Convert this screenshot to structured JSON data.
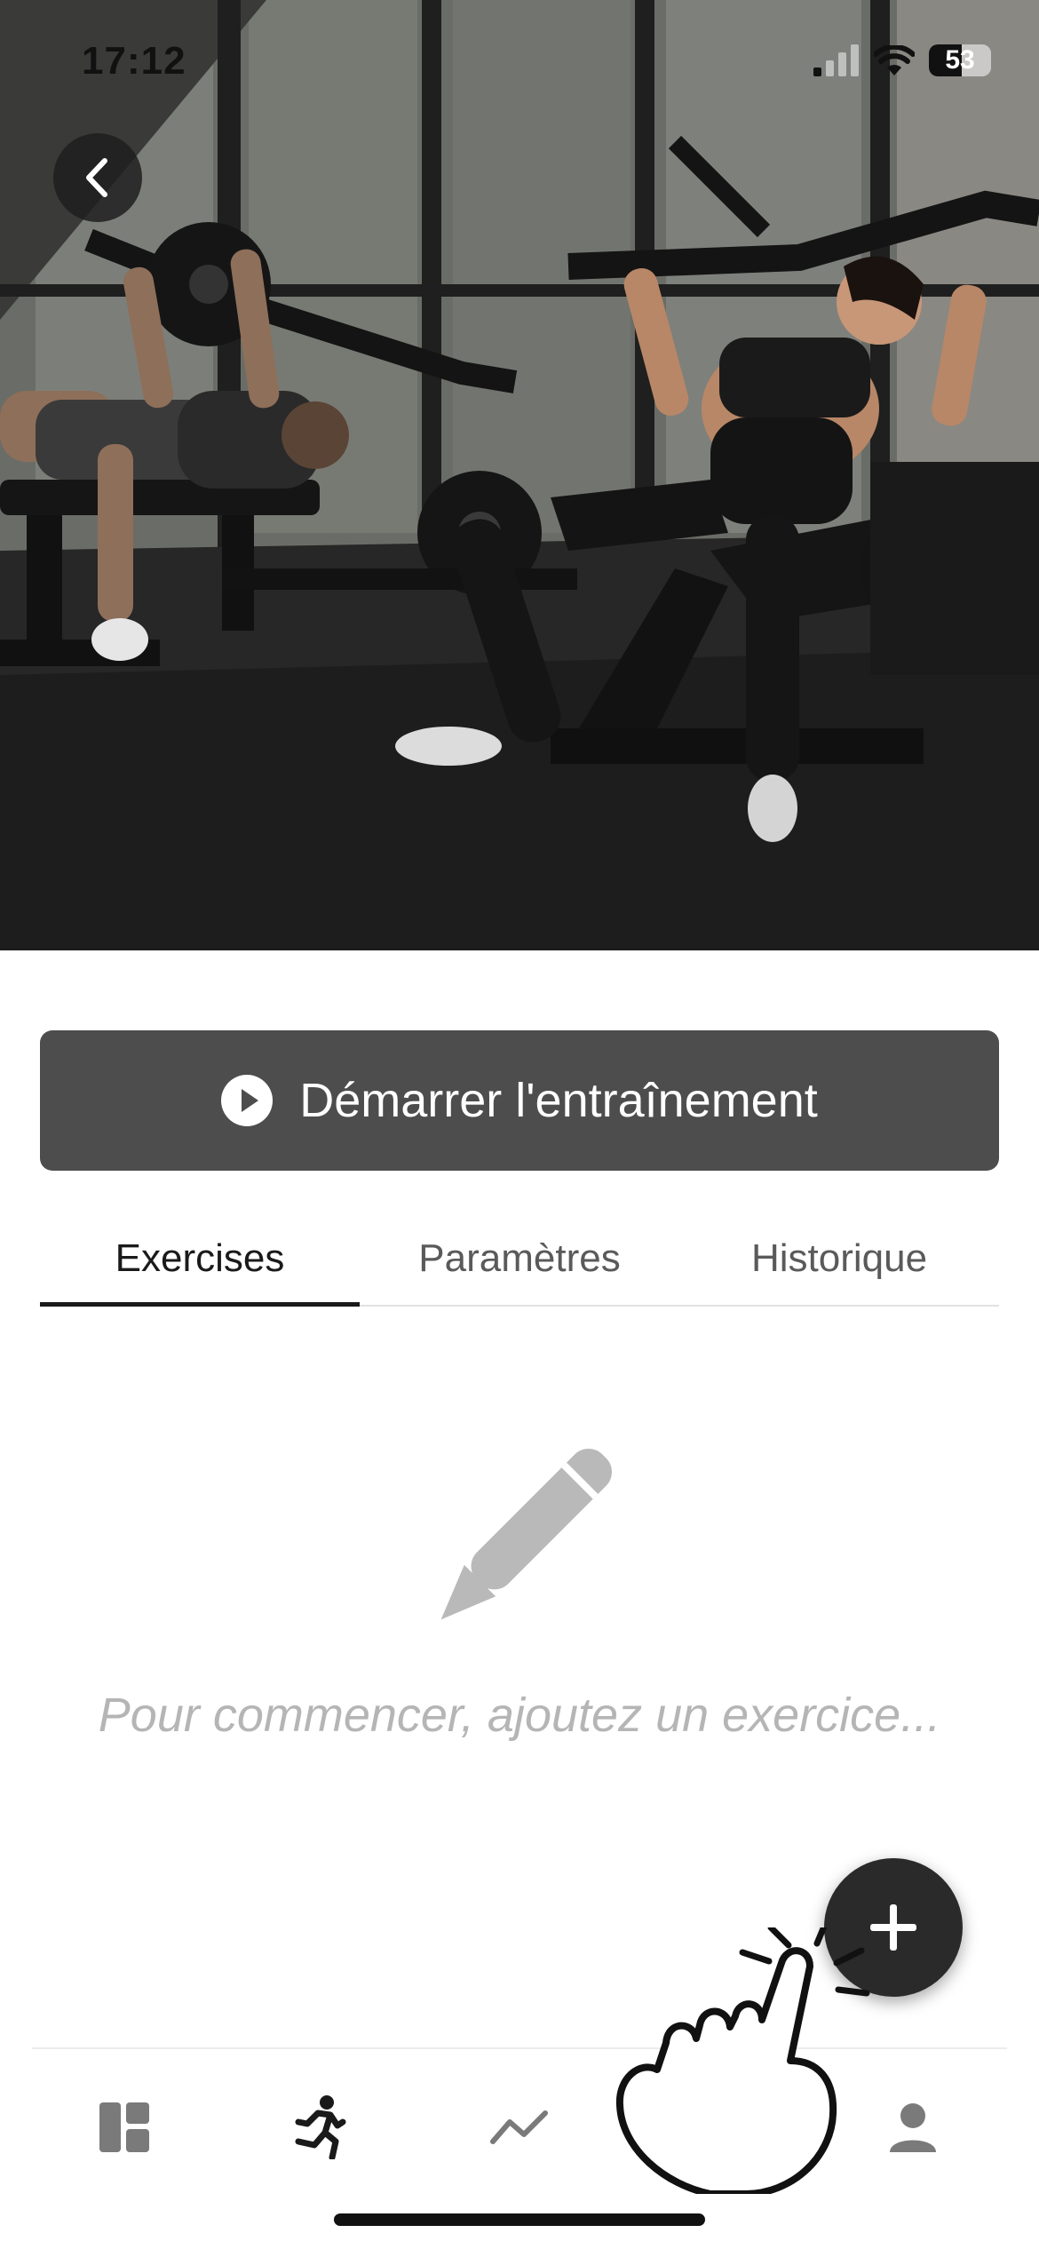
{
  "status_bar": {
    "time": "17:12",
    "battery_level": "53",
    "signal_icon": "cellular-signal-icon",
    "wifi_icon": "wifi-icon"
  },
  "header": {
    "back_icon": "chevron-left-icon"
  },
  "start_button": {
    "label": "Démarrer l'entraînement",
    "icon": "play-circle-icon"
  },
  "tabs": [
    {
      "label": "Exercises",
      "active": true
    },
    {
      "label": "Paramètres",
      "active": false
    },
    {
      "label": "Historique",
      "active": false
    }
  ],
  "empty_state": {
    "icon": "pencil-icon",
    "text": "Pour commencer, ajoutez un exercice..."
  },
  "fab": {
    "icon": "plus-icon"
  },
  "bottom_nav": [
    {
      "icon": "dashboard-icon",
      "active": false
    },
    {
      "icon": "running-icon",
      "active": true
    },
    {
      "icon": "trend-chart-icon",
      "active": false
    },
    {
      "icon": "hidden-item-icon",
      "active": false
    },
    {
      "icon": "person-icon",
      "active": false
    }
  ],
  "colors": {
    "primary_button": "#4d4d4d",
    "fab": "#2a2a2a",
    "text_active": "#1a1a1a",
    "text_muted": "#b5b5b5"
  }
}
